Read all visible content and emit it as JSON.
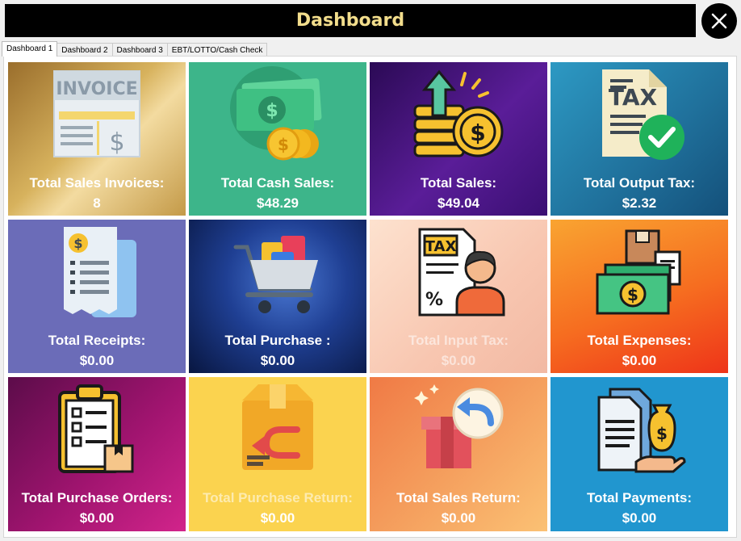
{
  "window": {
    "title": "Dashboard"
  },
  "tabs": [
    {
      "label": "Dashboard 1",
      "active": true
    },
    {
      "label": "Dashboard 2"
    },
    {
      "label": "Dashboard 3"
    },
    {
      "label": "EBT/LOTTO/Cash Check"
    }
  ],
  "cards": [
    {
      "label": "Total Sales Invoices:",
      "value": "8",
      "icon": "invoice-icon"
    },
    {
      "label": "Total Cash Sales:",
      "value": "$48.29",
      "icon": "cash-coins-icon"
    },
    {
      "label": "Total Sales:",
      "value": "$49.04",
      "icon": "sales-growth-icon"
    },
    {
      "label": "Total Output Tax:",
      "value": "$2.32",
      "icon": "tax-check-icon"
    },
    {
      "label": "Total Receipts:",
      "value": "$0.00",
      "icon": "receipt-icon"
    },
    {
      "label": "Total Purchase :",
      "value": "$0.00",
      "icon": "shopping-cart-icon"
    },
    {
      "label": "Total Input Tax:",
      "value": "$0.00",
      "icon": "tax-person-icon"
    },
    {
      "label": "Total Expenses:",
      "value": "$0.00",
      "icon": "expenses-icon"
    },
    {
      "label": "Total Purchase Orders:",
      "value": "$0.00",
      "icon": "clipboard-icon"
    },
    {
      "label": "Total Purchase Return:",
      "value": "$0.00",
      "icon": "return-box-icon"
    },
    {
      "label": "Total Sales Return:",
      "value": "$0.00",
      "icon": "sales-return-icon"
    },
    {
      "label": "Total Payments:",
      "value": "$0.00",
      "icon": "payments-icon"
    }
  ],
  "icon_text": {
    "invoice": "INVOICE",
    "tax": "TAX",
    "dollar": "$",
    "percent": "%"
  }
}
